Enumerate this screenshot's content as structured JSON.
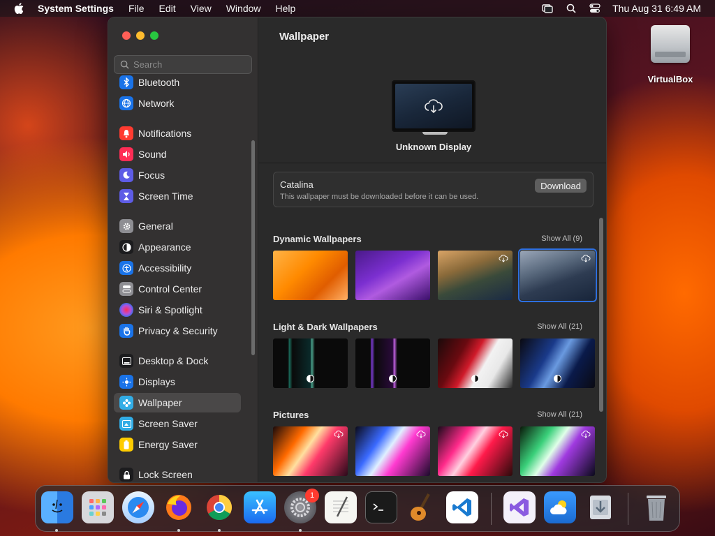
{
  "menubar": {
    "app_name": "System Settings",
    "menus": [
      "File",
      "Edit",
      "View",
      "Window",
      "Help"
    ],
    "clock": "Thu Aug 31  6:49 AM"
  },
  "desktop": {
    "icons": [
      {
        "label": "VirtualBox",
        "icon": "external-disk-icon"
      }
    ]
  },
  "sidebar": {
    "search_placeholder": "Search",
    "items": [
      {
        "label": "Bluetooth",
        "icon": "bluetooth-icon",
        "color": "#1a73e8"
      },
      {
        "label": "Network",
        "icon": "globe-icon",
        "color": "#1a73e8"
      },
      {
        "label": "Notifications",
        "icon": "bell-icon",
        "color": "#ff3b30"
      },
      {
        "label": "Sound",
        "icon": "speaker-icon",
        "color": "#ff2d55"
      },
      {
        "label": "Focus",
        "icon": "moon-icon",
        "color": "#5e5ce6"
      },
      {
        "label": "Screen Time",
        "icon": "hourglass-icon",
        "color": "#5e5ce6"
      },
      {
        "label": "General",
        "icon": "gear-icon",
        "color": "#8e8e93"
      },
      {
        "label": "Appearance",
        "icon": "appearance-icon",
        "color": "#1c1c1e"
      },
      {
        "label": "Accessibility",
        "icon": "accessibility-icon",
        "color": "#1a73e8"
      },
      {
        "label": "Control Center",
        "icon": "toggles-icon",
        "color": "#8e8e93"
      },
      {
        "label": "Siri & Spotlight",
        "icon": "siri-icon",
        "color": "#af52de"
      },
      {
        "label": "Privacy & Security",
        "icon": "hand-icon",
        "color": "#1a73e8"
      },
      {
        "label": "Desktop & Dock",
        "icon": "dock-icon",
        "color": "#1c1c1e"
      },
      {
        "label": "Displays",
        "icon": "sun-icon",
        "color": "#1a73e8"
      },
      {
        "label": "Wallpaper",
        "icon": "flower-icon",
        "color": "#32ade6"
      },
      {
        "label": "Screen Saver",
        "icon": "screensaver-icon",
        "color": "#32ade6"
      },
      {
        "label": "Energy Saver",
        "icon": "battery-icon",
        "color": "#ffcc00"
      },
      {
        "label": "Lock Screen",
        "icon": "lock-icon",
        "color": "#1c1c1e"
      }
    ],
    "active": "Wallpaper"
  },
  "main": {
    "title": "Wallpaper",
    "display_label": "Unknown Display",
    "notice": {
      "name": "Catalina",
      "description": "This wallpaper must be downloaded before it can be used.",
      "button_label": "Download"
    },
    "sections": [
      {
        "title": "Dynamic Wallpapers",
        "show_all": "Show All (9)"
      },
      {
        "title": "Light & Dark Wallpapers",
        "show_all": "Show All (21)"
      },
      {
        "title": "Pictures",
        "show_all": "Show All (21)"
      }
    ]
  },
  "dock": {
    "apps": [
      {
        "name": "Finder",
        "icon": "finder-icon",
        "running": true
      },
      {
        "name": "Launchpad",
        "icon": "launchpad-icon",
        "running": false
      },
      {
        "name": "Safari",
        "icon": "safari-icon",
        "running": false
      },
      {
        "name": "Firefox",
        "icon": "firefox-icon",
        "running": true
      },
      {
        "name": "Chrome",
        "icon": "chrome-icon",
        "running": true
      },
      {
        "name": "App Store",
        "icon": "app-store-icon",
        "running": false
      },
      {
        "name": "System Settings",
        "icon": "settings-icon",
        "running": true,
        "badge": "1"
      },
      {
        "name": "TextEdit",
        "icon": "textedit-icon",
        "running": false
      },
      {
        "name": "Terminal",
        "icon": "terminal-icon",
        "running": false
      },
      {
        "name": "GarageBand",
        "icon": "guitar-icon",
        "running": false
      },
      {
        "name": "VS Code",
        "icon": "vscode-icon",
        "running": false
      },
      {
        "name": "Visual Studio",
        "icon": "visual-studio-icon",
        "running": false
      },
      {
        "name": "Weather",
        "icon": "weather-icon",
        "running": false
      },
      {
        "name": "Downloads",
        "icon": "downloads-icon",
        "running": false
      },
      {
        "name": "Trash",
        "icon": "trash-icon",
        "running": false
      }
    ]
  }
}
